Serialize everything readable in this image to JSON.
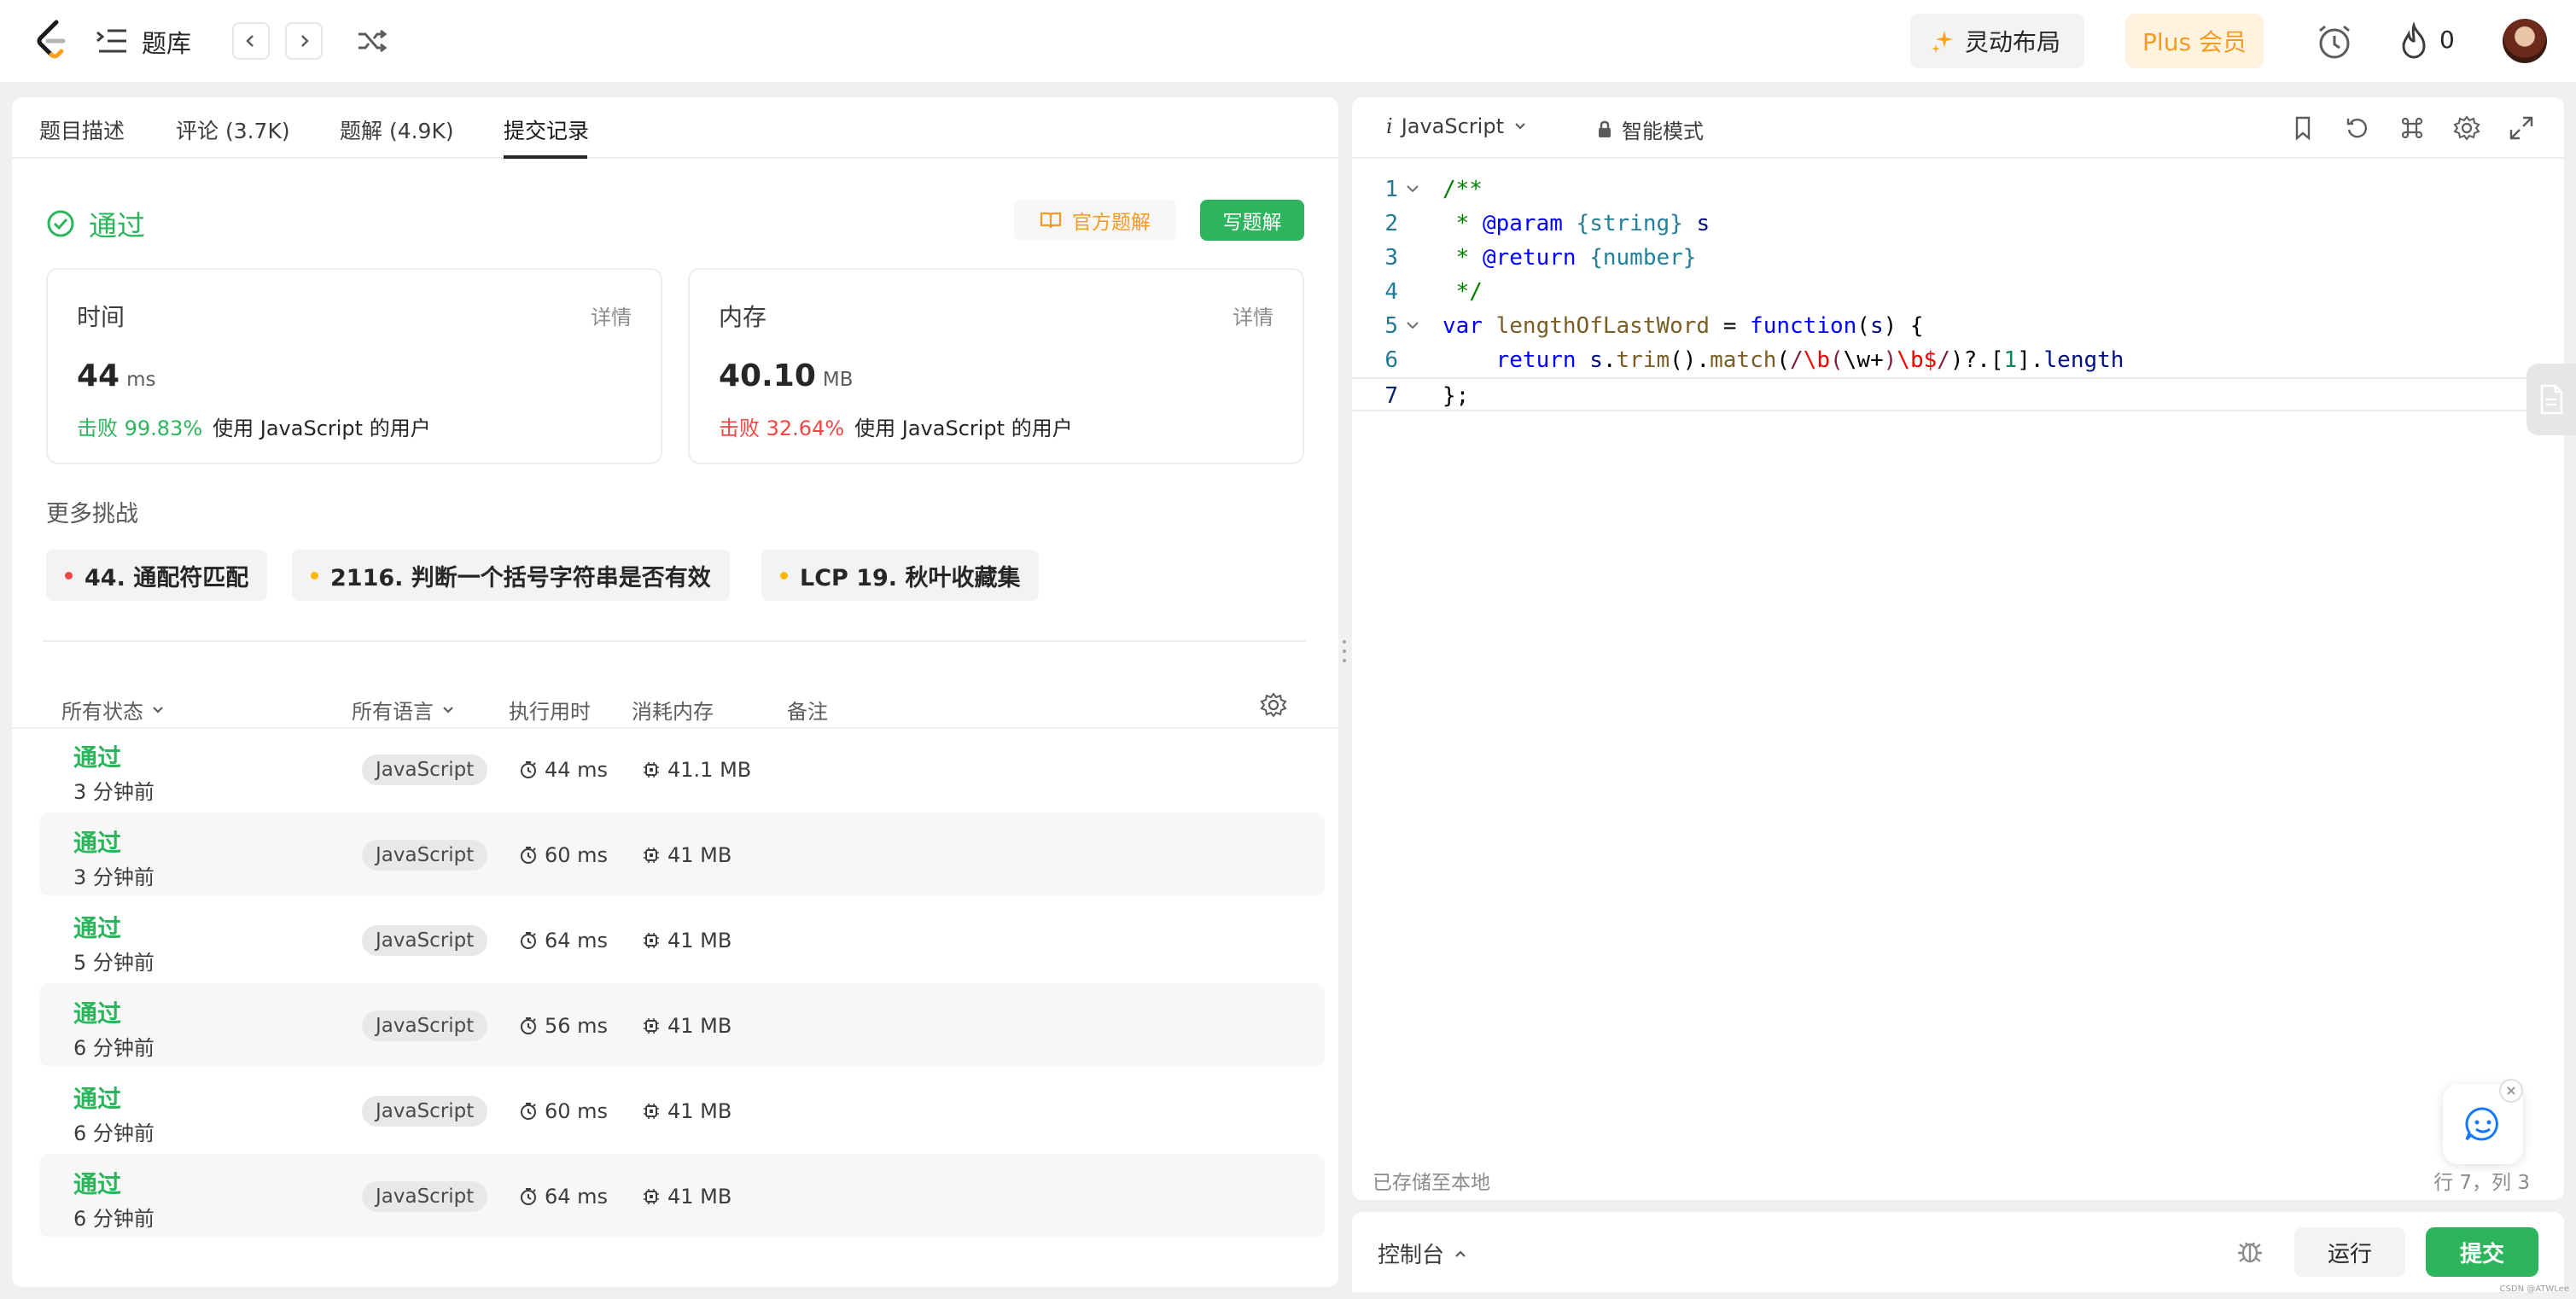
{
  "topbar": {
    "tiku_label": "题库",
    "layout_label": "灵动布局",
    "plus_label": "Plus 会员",
    "fire_count": "0"
  },
  "tabs": [
    {
      "label": "题目描述"
    },
    {
      "label": "评论 (3.7K)"
    },
    {
      "label": "题解 (4.9K)"
    },
    {
      "label": "提交记录"
    }
  ],
  "result": {
    "status": "通过",
    "official_label": "官方题解",
    "write_label": "写题解"
  },
  "stats": {
    "time": {
      "label": "时间",
      "detail": "详情",
      "value": "44",
      "unit": "ms",
      "beat": "击败 99.83%",
      "beat_suffix": "使用 JavaScript 的用户"
    },
    "memory": {
      "label": "内存",
      "detail": "详情",
      "value": "40.10",
      "unit": "MB",
      "beat": "击败 32.64%",
      "beat_suffix": "使用 JavaScript 的用户"
    }
  },
  "more_challenges": {
    "title": "更多挑战",
    "items": [
      {
        "label": "44. 通配符匹配",
        "color": "#ef4743"
      },
      {
        "label": "2116. 判断一个括号字符串是否有效",
        "color": "#ffb800"
      },
      {
        "label": "LCP 19. 秋叶收藏集",
        "color": "#ffb800"
      }
    ]
  },
  "table": {
    "headers": {
      "status": "所有状态",
      "language": "所有语言",
      "runtime": "执行用时",
      "memory": "消耗内存",
      "note": "备注"
    },
    "rows": [
      {
        "status": "通过",
        "time": "3 分钟前",
        "lang": "JavaScript",
        "runtime": "44 ms",
        "memory": "41.1 MB"
      },
      {
        "status": "通过",
        "time": "3 分钟前",
        "lang": "JavaScript",
        "runtime": "60 ms",
        "memory": "41 MB"
      },
      {
        "status": "通过",
        "time": "5 分钟前",
        "lang": "JavaScript",
        "runtime": "64 ms",
        "memory": "41 MB"
      },
      {
        "status": "通过",
        "time": "6 分钟前",
        "lang": "JavaScript",
        "runtime": "56 ms",
        "memory": "41 MB"
      },
      {
        "status": "通过",
        "time": "6 分钟前",
        "lang": "JavaScript",
        "runtime": "60 ms",
        "memory": "41 MB"
      },
      {
        "status": "通过",
        "time": "6 分钟前",
        "lang": "JavaScript",
        "runtime": "64 ms",
        "memory": "41 MB"
      }
    ]
  },
  "editor": {
    "language": "JavaScript",
    "mode": "智能模式",
    "lines": [
      {
        "num": "1",
        "html": "<span class='c-cm'>/**</span>"
      },
      {
        "num": "2",
        "html": "<span class='c-cm'> * </span><span class='c-tag'>@param</span><span class='c-cm'> </span><span class='c-type'>{string}</span><span class='c-cm'> </span><span class='c-id'>s</span>"
      },
      {
        "num": "3",
        "html": "<span class='c-cm'> * </span><span class='c-tag'>@return</span><span class='c-cm'> </span><span class='c-type'>{number}</span>"
      },
      {
        "num": "4",
        "html": "<span class='c-cm'> */</span>"
      },
      {
        "num": "5",
        "html": "<span class='c-kw'>var</span><span class='c-plain'> </span><span class='c-fn'>lengthOfLastWord</span><span class='c-plain'> = </span><span class='c-kw'>function</span><span class='c-plain'>(</span><span class='c-id'>s</span><span class='c-plain'>) {</span>"
      },
      {
        "num": "6",
        "html": "<span class='c-plain'>    </span><span class='c-kw'>return</span><span class='c-plain'> </span><span class='c-id'>s</span><span class='c-plain'>.</span><span class='c-fn'>trim</span><span class='c-plain'>().</span><span class='c-fn'>match</span><span class='c-plain'>(</span><span class='c-re'>/</span><span class='c-rs'>\\b</span><span class='c-re'>(</span><span class='c-plain'>\\w+</span><span class='c-re'>)</span><span class='c-rs'>\\b$</span><span class='c-re'>/</span><span class='c-plain'>)?.[</span><span class='c-num'>1</span><span class='c-plain'>].</span><span class='c-id'>length</span>"
      },
      {
        "num": "7",
        "html": "<span class='c-plain'>};</span>"
      }
    ],
    "saved": "已存储至本地",
    "cursor": "行 7，列 3"
  },
  "console": {
    "label": "控制台",
    "run": "运行",
    "submit": "提交"
  },
  "watermark": "CSDN @ATWLee"
}
